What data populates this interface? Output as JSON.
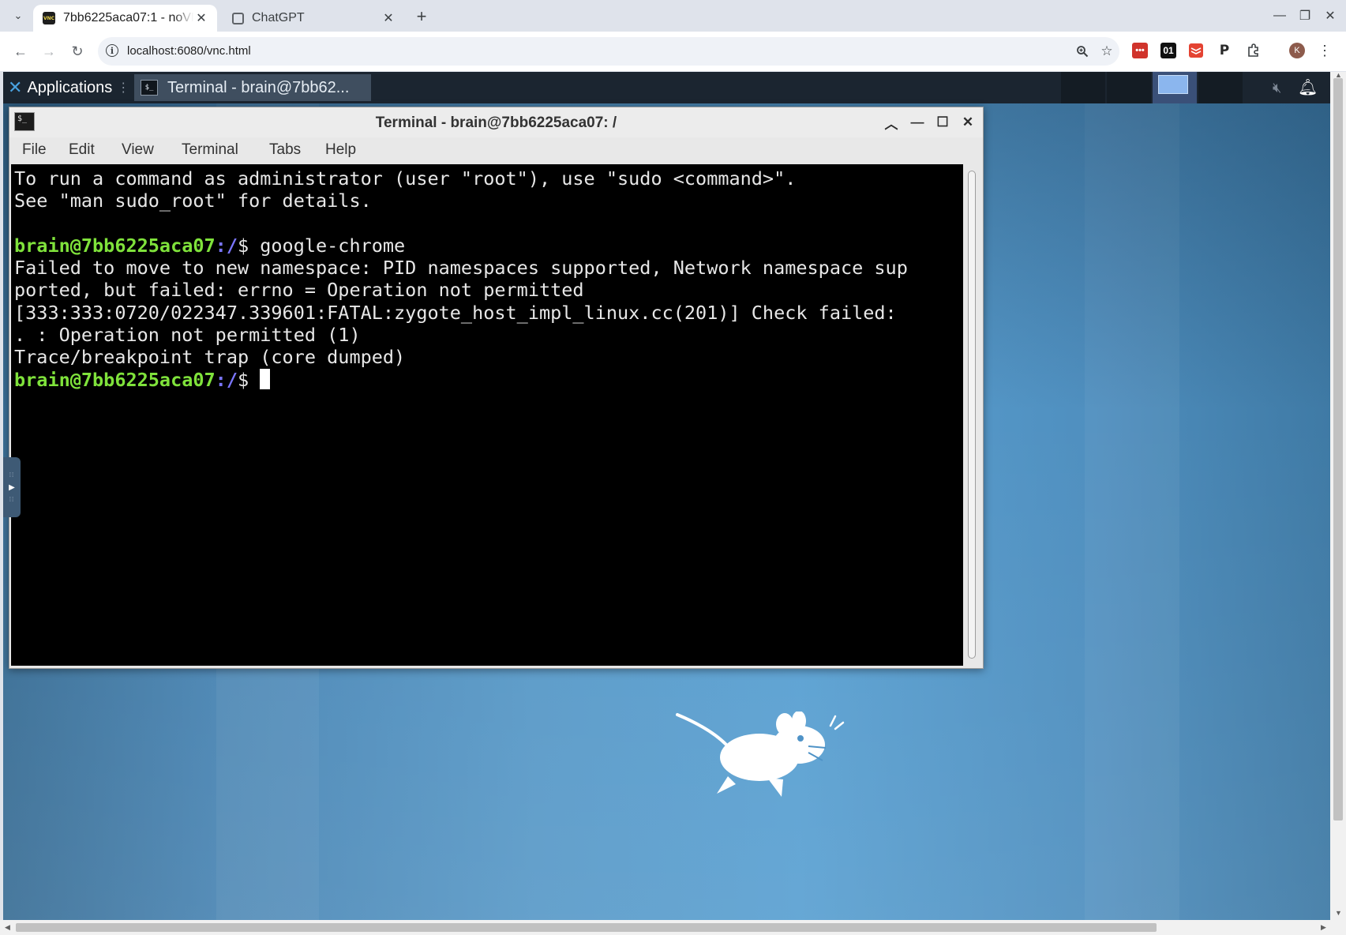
{
  "browser": {
    "tab_list_icon": "chevron-down-icon",
    "tabs": [
      {
        "title": "7bb6225aca07:1 - noVNC",
        "favicon": "novnc-favicon",
        "active": true
      },
      {
        "title": "ChatGPT",
        "favicon": "chatgpt-favicon",
        "active": false
      }
    ],
    "url": "localhost:6080/vnc.html",
    "profile_initial": "K",
    "extensions": [
      "lastpass-extension-icon",
      "01-extension-icon",
      "todoist-extension-icon",
      "p-extension-icon",
      "puzzle-extensions-icon"
    ],
    "extension_labels": {
      "ext1": "•••",
      "ext2": "01",
      "ext4": "P"
    }
  },
  "desktop": {
    "panel": {
      "applications_label": "Applications",
      "task_title": "Terminal - brain@7bb62..."
    },
    "terminal": {
      "window_title": "Terminal - brain@7bb6225aca07: /",
      "menu": [
        "File",
        "Edit",
        "View",
        "Terminal",
        "Tabs",
        "Help"
      ],
      "prompt_user": "brain@7bb6225aca07",
      "prompt_path": ":/",
      "prompt_symbol": "$ ",
      "lines": [
        "To run a command as administrator (user \"root\"), use \"sudo <command>\".",
        "See \"man sudo_root\" for details.",
        "",
        "google-chrome",
        "Failed to move to new namespace: PID namespaces supported, Network namespace sup",
        "ported, but failed: errno = Operation not permitted",
        "[333:333:0720/022347.339601:FATAL:zygote_host_impl_linux.cc(201)] Check failed:",
        ". : Operation not permitted (1)",
        "Trace/breakpoint trap (core dumped)",
        ""
      ]
    }
  }
}
